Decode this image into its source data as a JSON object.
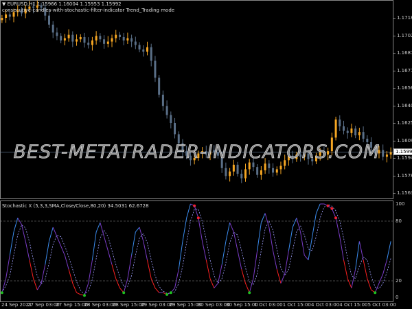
{
  "header": {
    "symbol_line": "▼ EURUSD,H1  1.15966 1.16004 1.15953 1.15992",
    "indicator_line": "consecutive-candles-with-stochastic-filter-indicator Trend_Trading mode"
  },
  "watermark": "BEST-METATRADER-INDICATORS.COM",
  "price_axis": [
    "1.17180",
    "1.17025",
    "1.16870",
    "1.16715",
    "1.16560",
    "1.16405",
    "1.16250",
    "1.16095",
    "1.15940",
    "1.15785",
    "1.15630"
  ],
  "current_price": "1.15992",
  "indicator": {
    "label": "Stochastic X (5,3,3,SMA,Close/Close,80,20) 34.5031 62.6728",
    "levels": [
      "100",
      "80",
      "20",
      "0"
    ]
  },
  "time_axis": [
    "24 Sep 2021",
    "27 Sep 03:00",
    "27 Sep 15:00",
    "28 Sep 03:00",
    "28 Sep 15:00",
    "29 Sep 03:00",
    "29 Sep 15:00",
    "30 Sep 03:00",
    "30 Sep 15:00",
    "1 Oct 03:00",
    "1 Oct 15:00",
    "4 Oct 03:00",
    "4 Oct 15:00",
    "5 Oct 03:00"
  ],
  "colors": {
    "bull": "#f5a623",
    "bear": "#5a6f87",
    "stoch_up": "#3b8cf0",
    "stoch_mid": "#7a3cc8",
    "stoch_down": "#ff2020",
    "signal": "#a0a0ff",
    "grid": "#888888"
  },
  "chart_data": {
    "type": "candlestick",
    "closes": [
      1.1718,
      1.1721,
      1.1719,
      1.1723,
      1.1725,
      1.1722,
      1.1726,
      1.1728,
      1.1727,
      1.1729,
      1.1727,
      1.172,
      1.1712,
      1.1705,
      1.1702,
      1.1698,
      1.17,
      1.1703,
      1.1697,
      1.1699,
      1.1701,
      1.1696,
      1.1694,
      1.1698,
      1.1702,
      1.1699,
      1.1695,
      1.1697,
      1.17,
      1.1703,
      1.1701,
      1.1698,
      1.17,
      1.1697,
      1.1694,
      1.169,
      1.1688,
      1.1692,
      1.168,
      1.1665,
      1.165,
      1.164,
      1.1632,
      1.1625,
      1.1615,
      1.1607,
      1.16,
      1.1596,
      1.1592,
      1.1594,
      1.1598,
      1.16,
      1.1597,
      1.1601,
      1.1599,
      1.1596,
      1.1585,
      1.1578,
      1.1582,
      1.1588,
      1.158,
      1.1576,
      1.1584,
      1.159,
      1.1586,
      1.1579,
      1.1583,
      1.1589,
      1.1585,
      1.1581,
      1.1584,
      1.1587,
      1.1592,
      1.1596,
      1.1593,
      1.1597,
      1.1595,
      1.1598,
      1.1593,
      1.1591,
      1.1596,
      1.1599,
      1.1597,
      1.16,
      1.1612,
      1.1628,
      1.1622,
      1.1618,
      1.1616,
      1.162,
      1.1614,
      1.1617,
      1.1611,
      1.1608,
      1.1603,
      1.1598,
      1.1601,
      1.1595,
      1.1597,
      1.1599
    ],
    "price_range": [
      1.156,
      1.1735
    ],
    "stochastic": [
      5,
      20,
      45,
      70,
      85,
      78,
      60,
      40,
      20,
      8,
      15,
      35,
      60,
      75,
      65,
      55,
      45,
      30,
      15,
      5,
      3,
      2,
      15,
      40,
      70,
      80,
      65,
      50,
      35,
      20,
      10,
      5,
      20,
      45,
      70,
      75,
      60,
      40,
      20,
      10,
      5,
      5,
      3,
      5,
      10,
      30,
      60,
      85,
      100,
      98,
      85,
      60,
      40,
      20,
      10,
      15,
      35,
      60,
      80,
      70,
      50,
      30,
      15,
      5,
      20,
      50,
      80,
      90,
      75,
      50,
      30,
      15,
      25,
      50,
      75,
      85,
      70,
      45,
      40,
      65,
      90,
      100,
      100,
      98,
      95,
      85,
      65,
      40,
      20,
      10,
      30,
      60,
      40,
      20,
      8,
      5,
      15,
      25,
      40,
      60
    ],
    "stoch_range": [
      0,
      100
    ]
  }
}
